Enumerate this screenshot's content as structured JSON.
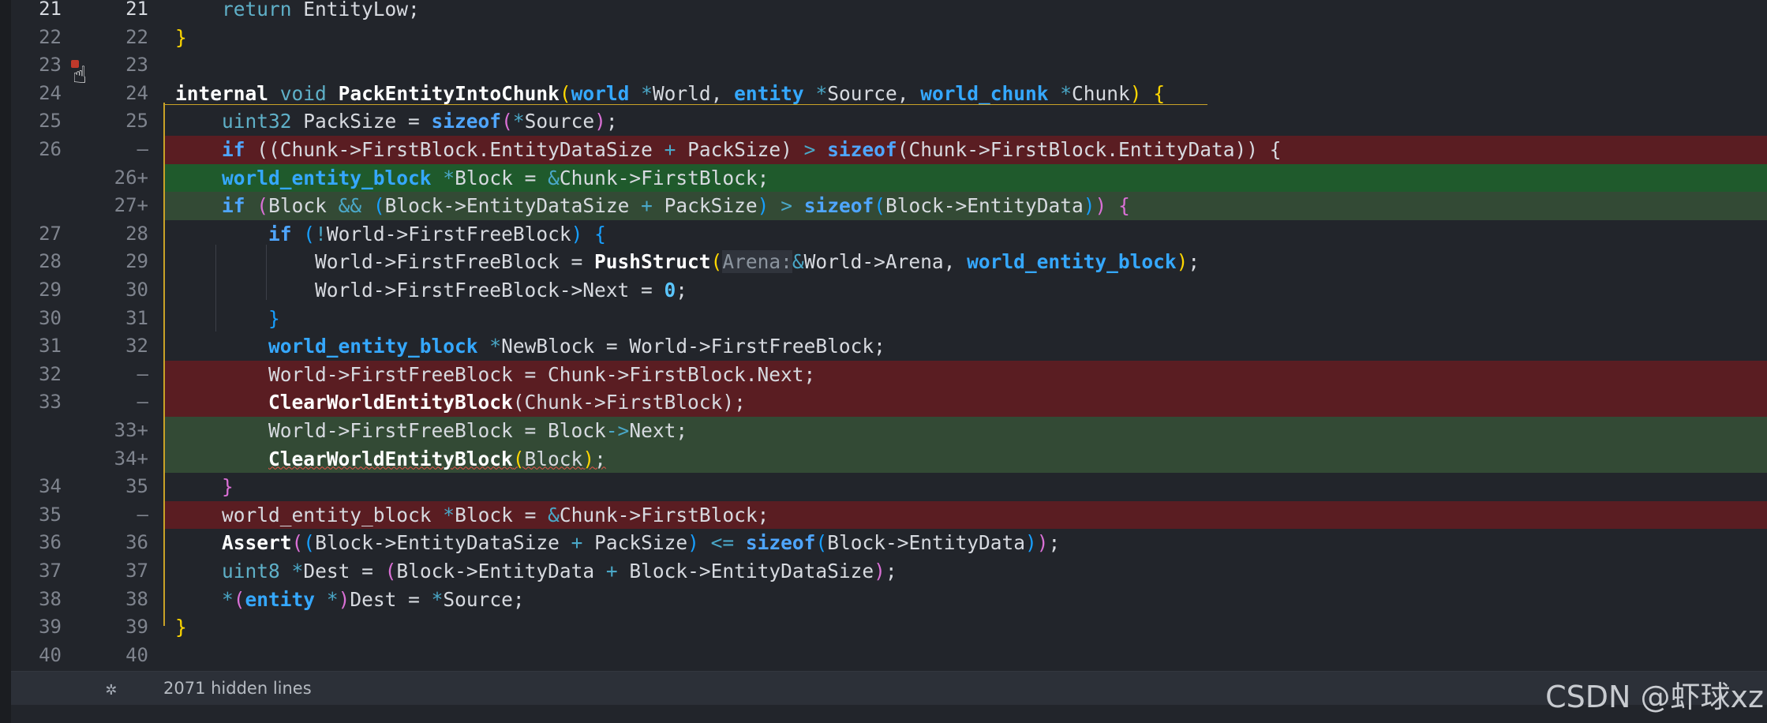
{
  "editor": {
    "lines": [
      {
        "old": "21",
        "new": "21",
        "type": "ctx",
        "active": true
      },
      {
        "old": "22",
        "new": "22",
        "type": "ctx"
      },
      {
        "old": "23",
        "new": "23",
        "type": "ctx"
      },
      {
        "old": "24",
        "new": "24",
        "type": "ctx"
      },
      {
        "old": "25",
        "new": "25",
        "type": "ctx"
      },
      {
        "old": "26",
        "new": "—",
        "type": "del"
      },
      {
        "old": "",
        "new": "26+",
        "type": "add",
        "strong": true
      },
      {
        "old": "",
        "new": "27+",
        "type": "add"
      },
      {
        "old": "27",
        "new": "28",
        "type": "ctx"
      },
      {
        "old": "28",
        "new": "29",
        "type": "ctx"
      },
      {
        "old": "29",
        "new": "30",
        "type": "ctx"
      },
      {
        "old": "30",
        "new": "31",
        "type": "ctx"
      },
      {
        "old": "31",
        "new": "32",
        "type": "ctx"
      },
      {
        "old": "32",
        "new": "—",
        "type": "del"
      },
      {
        "old": "33",
        "new": "—",
        "type": "del"
      },
      {
        "old": "",
        "new": "33+",
        "type": "add"
      },
      {
        "old": "",
        "new": "34+",
        "type": "add"
      },
      {
        "old": "34",
        "new": "35",
        "type": "ctx"
      },
      {
        "old": "35",
        "new": "—",
        "type": "del"
      },
      {
        "old": "36",
        "new": "36",
        "type": "ctx"
      },
      {
        "old": "37",
        "new": "37",
        "type": "ctx"
      },
      {
        "old": "38",
        "new": "38",
        "type": "ctx"
      },
      {
        "old": "39",
        "new": "39",
        "type": "ctx"
      },
      {
        "old": "40",
        "new": "40",
        "type": "ctx"
      }
    ],
    "code": {
      "l0_kw": "return",
      "l0_rest": " EntityLow;",
      "l1": "}",
      "l3_internal": "internal",
      "l3_void": "void",
      "l3_fn": "PackEntityIntoChunk",
      "l3_t1": "world",
      "l3_p1": "World, ",
      "l3_t2": "entity",
      "l3_p2": "Source, ",
      "l3_t3": "world_chunk",
      "l3_p3": "Chunk",
      "l4_type": "uint32",
      "l4_a": " PackSize = ",
      "l4_sizeof": "sizeof",
      "l4_b": "Source",
      "l5_if": "if",
      "l5_a": "Chunk->FirstBlock",
      "l5_b": ".EntityDataSize",
      "l5_c": " PackSize",
      "l5_sizeof": "sizeof",
      "l5_d": "Chunk->FirstBlock",
      "l5_e": ".EntityData",
      "l6_type": "world_entity_block",
      "l6_a": "Block = ",
      "l6_b": "Chunk->FirstBlock;",
      "l7_if": "if",
      "l7_a": "Block ",
      "l7_b": "Block->EntityDataSize ",
      "l7_c": " PackSize",
      "l7_sizeof": "sizeof",
      "l7_d": "Block->EntityData",
      "l8_if": "if",
      "l8_a": "World->FirstFreeBlock",
      "l9_a": "World->FirstFreeBlock = ",
      "l9_fn": "PushStruct",
      "l9_hint": "Arena:",
      "l9_b": "World->Arena, ",
      "l9_type": "world_entity_block",
      "l10_a": "World->FirstFreeBlock->Next = ",
      "l10_num": "0",
      "l11": "}",
      "l12_type": "world_entity_block",
      "l12_a": "NewBlock = World->FirstFreeBlock;",
      "l13_a": "World->FirstFreeBlock = ",
      "l13_b": "Chunk->FirstBlock",
      "l13_c": ".Next;",
      "l14_fn": "ClearWorldEntityBlock",
      "l14_a": "Chunk->FirstBlock",
      "l15_a": "World->FirstFreeBlock = ",
      "l15_b": "Block",
      "l15_c": "->",
      "l15_d": "Next;",
      "l16_fn": "ClearWorldEntityBlock",
      "l16_a": "Block",
      "l17": "}",
      "l18_type": "world_entity_block",
      "l18_a": "Block = ",
      "l18_b": "Chunk->FirstBlock;",
      "l19_fn": "Assert",
      "l19_a": "Block->EntityDataSize ",
      "l19_b": " PackSize",
      "l19_sizeof": "sizeof",
      "l19_c": "Block->EntityData",
      "l20_type": "uint8",
      "l20_a": "Dest = ",
      "l20_b": "Block->EntityData ",
      "l20_c": " Block->EntityDataSize",
      "l21_type": "entity",
      "l21_a": "Dest = ",
      "l21_b": "Source;",
      "l22": "}"
    }
  },
  "footer": {
    "icon": "unfold-icon",
    "hidden_label": "2071 hidden lines"
  },
  "watermark": "CSDN @虾球xz",
  "colors": {
    "background": "#22252b",
    "deleted": "#5a1d22",
    "added": "#334a35",
    "added_strong": "#1f5a2c",
    "keyword": "#4fa6ff",
    "guide": "#c9a227"
  }
}
